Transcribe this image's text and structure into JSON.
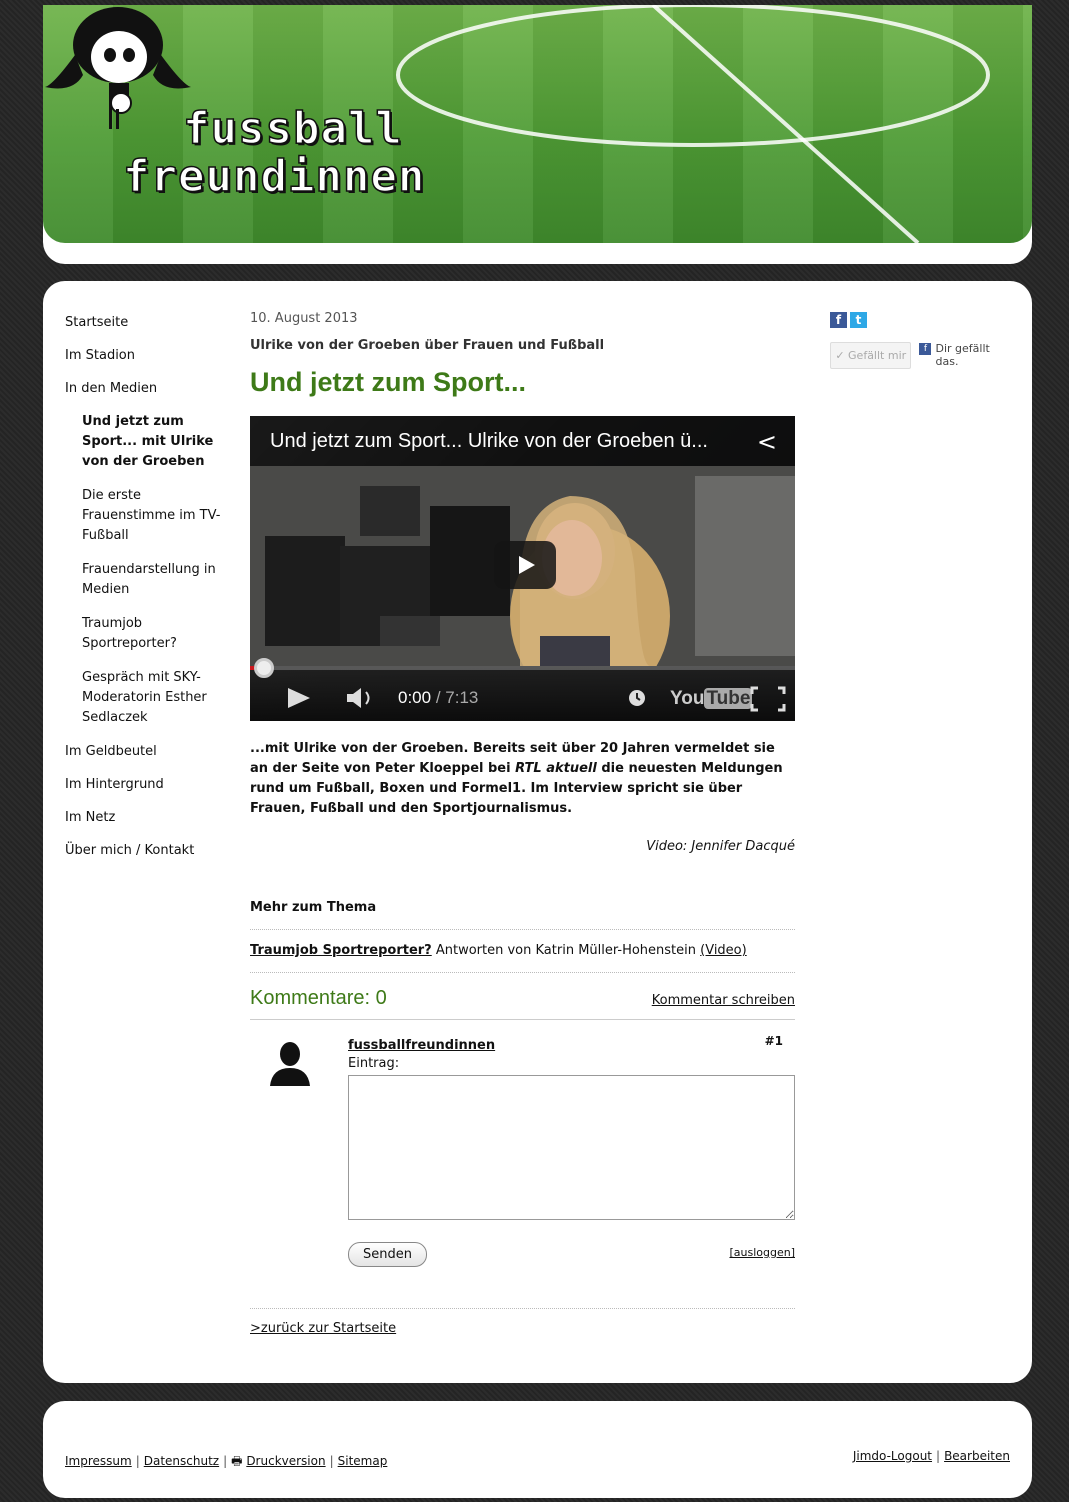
{
  "header": {
    "logo_line1": "fussball",
    "logo_line2": "freundinnen"
  },
  "nav": {
    "items": [
      {
        "label": "Startseite"
      },
      {
        "label": "Im Stadion"
      },
      {
        "label": "In den Medien"
      }
    ],
    "subitems": [
      {
        "label": "Und jetzt zum Sport... mit Ulrike von der Groeben",
        "active": true
      },
      {
        "label": "Die erste Frauenstimme im TV-Fußball"
      },
      {
        "label": "Frauendarstellung in Medien"
      },
      {
        "label": "Traumjob Sportreporter?"
      },
      {
        "label": "Gespräch mit SKY-Moderatorin Esther Sedlaczek"
      }
    ],
    "items_after": [
      {
        "label": "Im Geldbeutel"
      },
      {
        "label": "Im Hintergrund"
      },
      {
        "label": "Im Netz"
      },
      {
        "label": "Über mich / Kontakt"
      }
    ]
  },
  "article": {
    "date": "10. August 2013",
    "subtitle": "Ulrike von der Groeben über Frauen und Fußball",
    "headline": "Und jetzt zum Sport...",
    "video": {
      "title": "Und jetzt zum Sport... Ulrike von der Groeben ü...",
      "time_current": "0:00",
      "time_total": "/ 7:13",
      "progress": 0.01,
      "youtube_you": "You",
      "youtube_tube": "Tube"
    },
    "lead_part1": "...mit Ulrike von der Groeben. Bereits seit über 20 Jahren vermeldet sie an der Seite von Peter Kloeppel bei ",
    "lead_italic": "RTL aktuell",
    "lead_part2": " die neuesten Meldungen rund um Fußball, Boxen und Formel1. Im Interview spricht sie über Frauen, Fußball und den Sportjournalismus.",
    "credit": "Video: Jennifer Dacqué",
    "more_title": "Mehr zum Thema",
    "related_strong": "Traumjob Sportreporter?",
    "related_text": " Antworten von Katrin Müller-Hohenstein ",
    "related_video": "(Video)",
    "back_link": ">zurück zur Startseite"
  },
  "comments": {
    "title": "Kommentare: 0",
    "write_link": "Kommentar schreiben",
    "author": "fussballfreundinnen",
    "number": "#1",
    "entry_label": "Eintrag:",
    "entry_value": "",
    "send_label": "Senden",
    "logout_label": "[ausloggen]"
  },
  "social": {
    "fb_icon": "f",
    "tw_icon": "t",
    "like_button": "✓ Gefällt mir",
    "like_text": "Dir gefällt das."
  },
  "footer": {
    "impressum": "Impressum",
    "datenschutz": "Datenschutz",
    "druckversion": "Druckversion",
    "sitemap": "Sitemap",
    "jimdo_logout": "Jimdo-Logout",
    "bearbeiten": "Bearbeiten",
    "sep": "|"
  }
}
